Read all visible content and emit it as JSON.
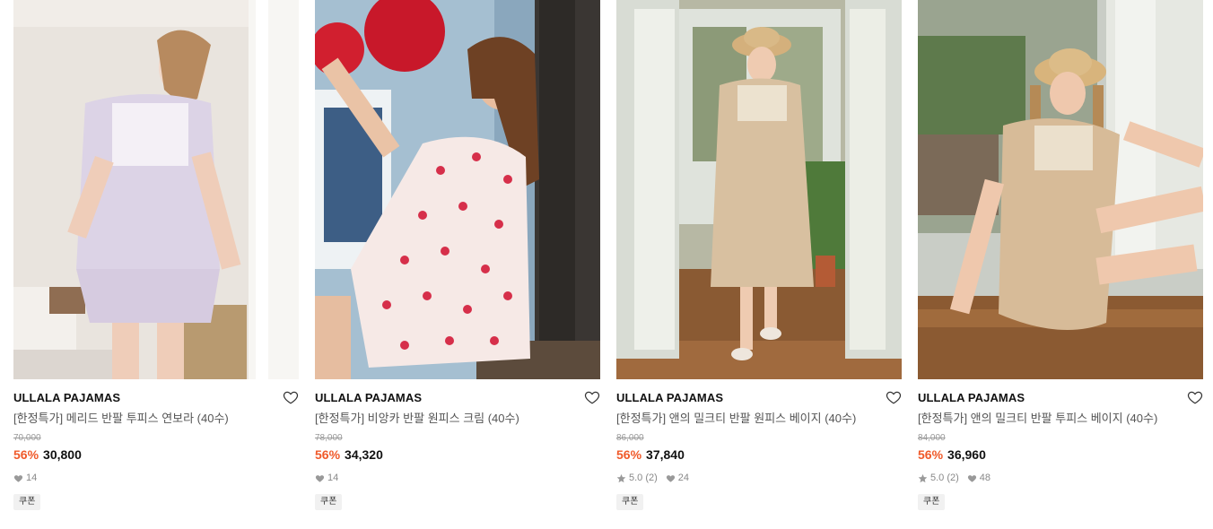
{
  "products": [
    {
      "brand": "ULLALA PAJAMAS",
      "name": "[한정특가] 메리드 반팔 투피스 연보라 (40수)",
      "original_price": "70,000",
      "discount": "56%",
      "sale_price": "30,800",
      "rating": "",
      "likes": "14",
      "coupon": "쿠폰"
    },
    {
      "brand": "ULLALA PAJAMAS",
      "name": "[한정특가] 비앙카 반팔 원피스 크림 (40수)",
      "original_price": "78,000",
      "discount": "56%",
      "sale_price": "34,320",
      "rating": "",
      "likes": "14",
      "coupon": "쿠폰"
    },
    {
      "brand": "ULLALA PAJAMAS",
      "name": "[한정특가] 앤의 밀크티 반팔 원피스 베이지 (40수)",
      "original_price": "86,000",
      "discount": "56%",
      "sale_price": "37,840",
      "rating": "5.0 (2)",
      "likes": "24",
      "coupon": "쿠폰"
    },
    {
      "brand": "ULLALA PAJAMAS",
      "name": "[한정특가] 앤의 밀크티 반팔 투피스 베이지 (40수)",
      "original_price": "84,000",
      "discount": "56%",
      "sale_price": "36,960",
      "rating": "5.0 (2)",
      "likes": "48",
      "coupon": "쿠폰"
    }
  ],
  "icons": {
    "wishlist": "heart-outline-icon",
    "like": "heart-filled-icon",
    "rating": "star-icon"
  },
  "colors": {
    "discount": "#f05a2a",
    "brand_text": "#111111",
    "meta_text": "#888888"
  }
}
